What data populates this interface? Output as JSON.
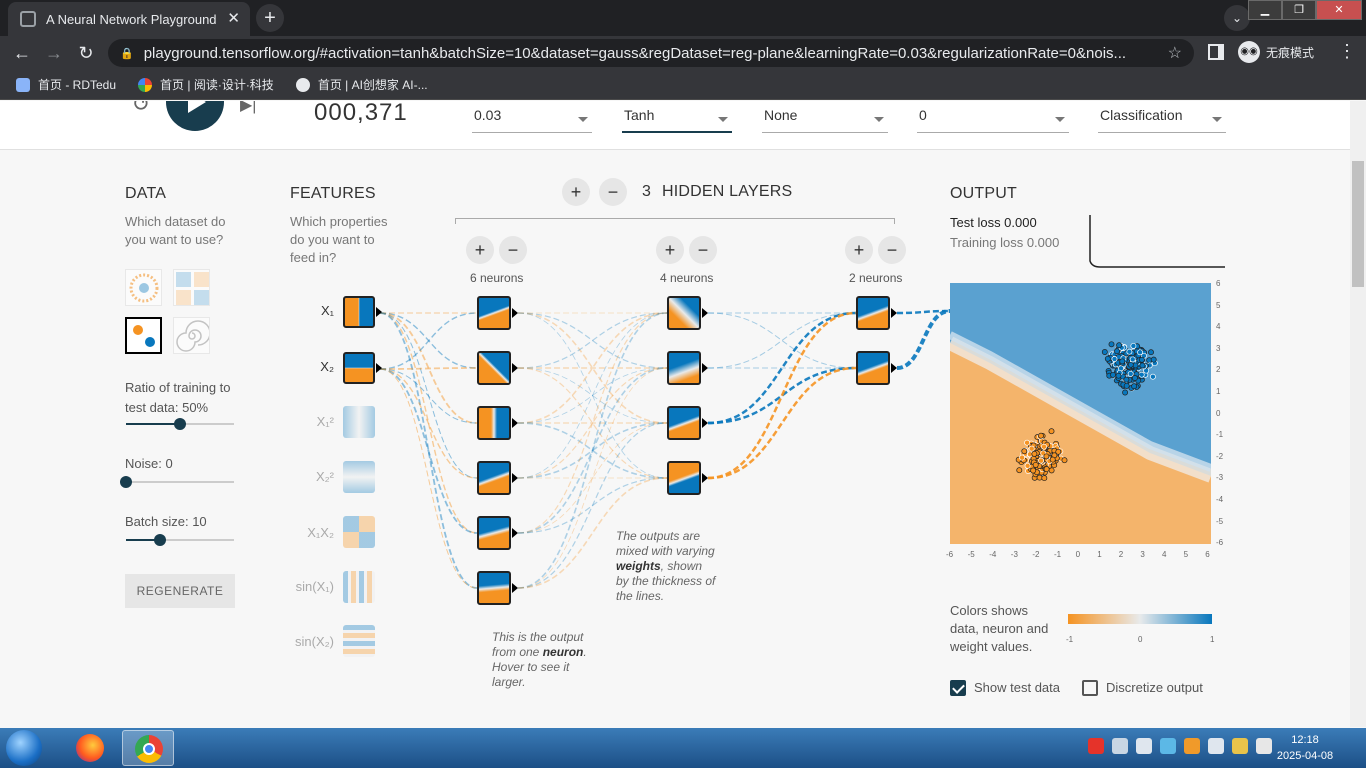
{
  "browser": {
    "tab_title": "A Neural Network Playground",
    "tab_close": "✕",
    "new_tab": "+",
    "tab_search": "⌄",
    "url": "playground.tensorflow.org/#activation=tanh&batchSize=10&dataset=gauss&regDataset=reg-plane&learningRate=0.03&regularizationRate=0&nois...",
    "incognito_label": "无痕模式",
    "bookmarks": [
      {
        "label": "首页 - RDTedu",
        "color": "#8ab4f8"
      },
      {
        "label": "首页 | 阅读·设计·科技",
        "color": "#fbbc04"
      },
      {
        "label": "首页 | AI创想家 AI-...",
        "color": "#e8eaed"
      }
    ],
    "window_buttons": [
      "▁",
      "❐",
      "✕"
    ]
  },
  "controls": {
    "epoch": "000,371",
    "learning_rate": "0.03",
    "activation": "Tanh",
    "regularization": "None",
    "regularization_rate": "0",
    "problem_type": "Classification"
  },
  "data_panel": {
    "heading": "DATA",
    "question": "Which dataset do you want to use?",
    "ratio_label": "Ratio of training to test data:  50%",
    "ratio_value": 50,
    "noise_label": "Noise:  0",
    "noise_value": 0,
    "batch_label": "Batch size:  10",
    "batch_value": 10,
    "regenerate_label": "REGENERATE"
  },
  "features_panel": {
    "heading": "FEATURES",
    "question": "Which properties do you want to feed in?",
    "features": [
      {
        "label": "X₁",
        "active": true
      },
      {
        "label": "X₂",
        "active": true
      },
      {
        "label": "X₁²",
        "active": false
      },
      {
        "label": "X₂²",
        "active": false
      },
      {
        "label": "X₁X₂",
        "active": false
      },
      {
        "label": "sin(X₁)",
        "active": false
      },
      {
        "label": "sin(X₂)",
        "active": false
      }
    ]
  },
  "network": {
    "hidden_layer_count": "3",
    "hidden_layers_label": "HIDDEN LAYERS",
    "plus": "+",
    "minus": "−",
    "layers": [
      {
        "neurons_label": "6 neurons",
        "count": 6
      },
      {
        "neurons_label": "4 neurons",
        "count": 4
      },
      {
        "neurons_label": "2 neurons",
        "count": 2
      }
    ],
    "note_neuron": {
      "pre": "This is the output from one ",
      "bold": "neuron",
      "post": ". Hover to see it larger."
    },
    "note_weights": {
      "pre": "The outputs are mixed with varying ",
      "bold": "weights",
      "post": ", shown by the thickness of the lines."
    }
  },
  "output_panel": {
    "heading": "OUTPUT",
    "test_loss": "Test loss 0.000",
    "training_loss": "Training loss 0.000",
    "y_ticks": [
      "6",
      "5",
      "4",
      "3",
      "2",
      "1",
      "0",
      "-1",
      "-2",
      "-3",
      "-4",
      "-5",
      "-6"
    ],
    "x_ticks": [
      "-6",
      "-5",
      "-4",
      "-3",
      "-2",
      "-1",
      "0",
      "1",
      "2",
      "3",
      "4",
      "5",
      "6"
    ],
    "legend_text": "Colors shows data, neuron and weight values.",
    "legend_ticks": [
      "-1",
      "0",
      "1"
    ],
    "show_test_data": "Show test data",
    "discretize_output": "Discretize output",
    "colors": {
      "positive": "#0877bd",
      "negative": "#f59322"
    }
  },
  "taskbar": {
    "time": "12:18",
    "date": "2025-04-08"
  }
}
